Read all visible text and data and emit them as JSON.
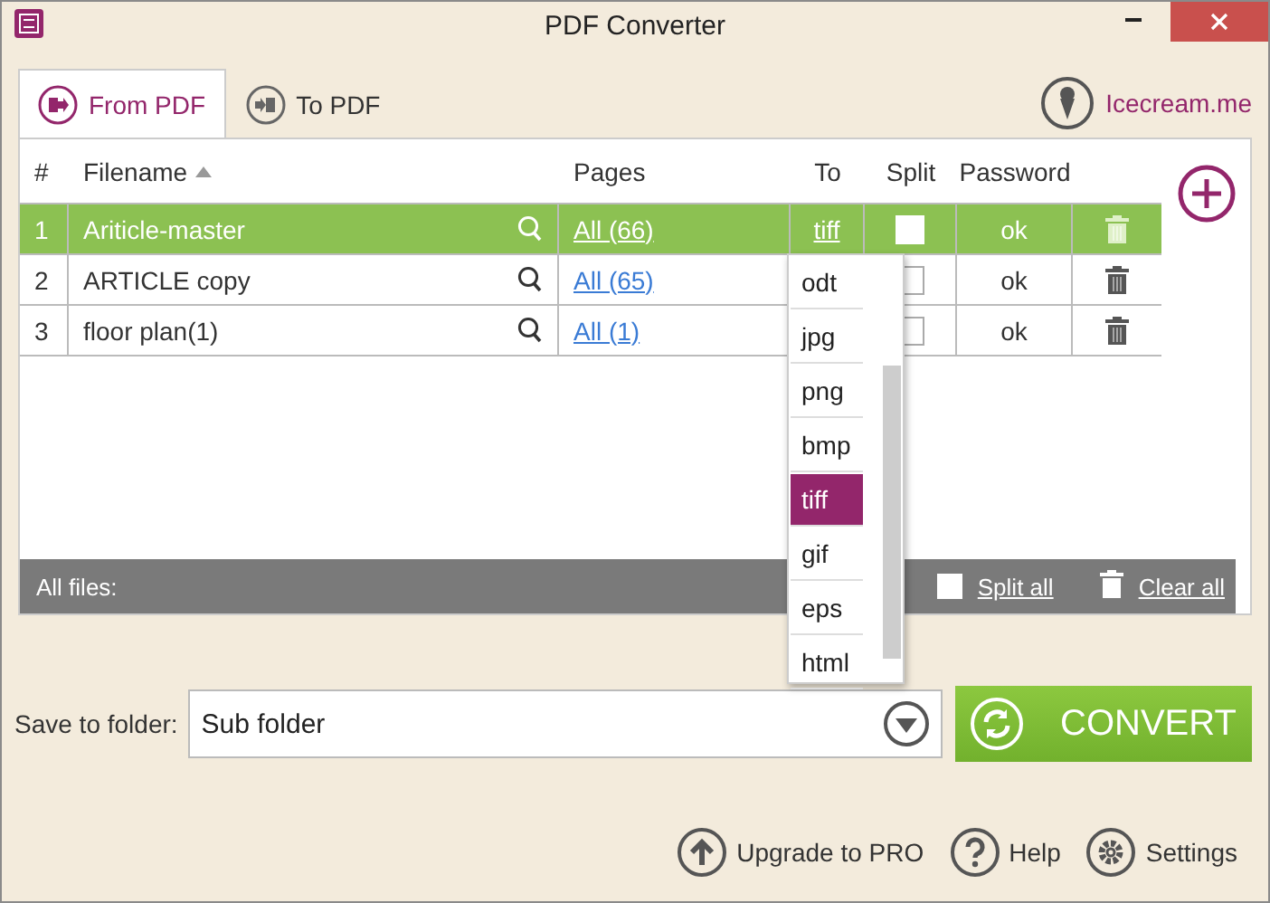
{
  "window": {
    "title": "PDF Converter"
  },
  "tabs": [
    {
      "label": "From PDF",
      "selected": true,
      "kind": "from"
    },
    {
      "label": "To PDF",
      "selected": false,
      "kind": "to"
    }
  ],
  "brand_link": "Icecream.me",
  "table": {
    "columns": [
      {
        "label": "#",
        "sorted": false
      },
      {
        "label": "Filename",
        "sorted": true
      },
      {
        "label": "Pages",
        "sorted": false
      },
      {
        "label": "To",
        "sorted": false
      },
      {
        "label": "Split",
        "sorted": false
      },
      {
        "label": "Password",
        "sorted": false
      }
    ],
    "rows": [
      {
        "number": "1",
        "filename": "Ariticle-master",
        "pages": "All (66)",
        "to": "tiff",
        "split": false,
        "password": "ok",
        "selected": true
      },
      {
        "number": "2",
        "filename": "ARTICLE copy",
        "pages": "All (65)",
        "split": false,
        "password": "ok",
        "selected": false
      },
      {
        "number": "3",
        "filename": "floor plan(1)",
        "pages": "All (1)",
        "split": false,
        "password": "ok",
        "selected": false
      }
    ],
    "footer": {
      "label": "All files:",
      "split_all": {
        "label": "Split all",
        "checked": false
      },
      "clear_all": "Clear all"
    }
  },
  "format_dropdown": {
    "items": [
      {
        "label": "odt",
        "selected": false
      },
      {
        "label": "jpg",
        "selected": false
      },
      {
        "label": "png",
        "selected": false
      },
      {
        "label": "bmp",
        "selected": false
      },
      {
        "label": "tiff",
        "selected": true
      },
      {
        "label": "gif",
        "selected": false
      },
      {
        "label": "eps",
        "selected": false
      },
      {
        "label": "html",
        "selected": false
      }
    ]
  },
  "save": {
    "label": "Save to folder:",
    "value": "Sub folder"
  },
  "convert_button": "CONVERT",
  "bottom_links": [
    {
      "label": "Upgrade to PRO",
      "kind": "upgrade"
    },
    {
      "label": "Help",
      "kind": "help"
    },
    {
      "label": "Settings",
      "kind": "settings"
    }
  ]
}
